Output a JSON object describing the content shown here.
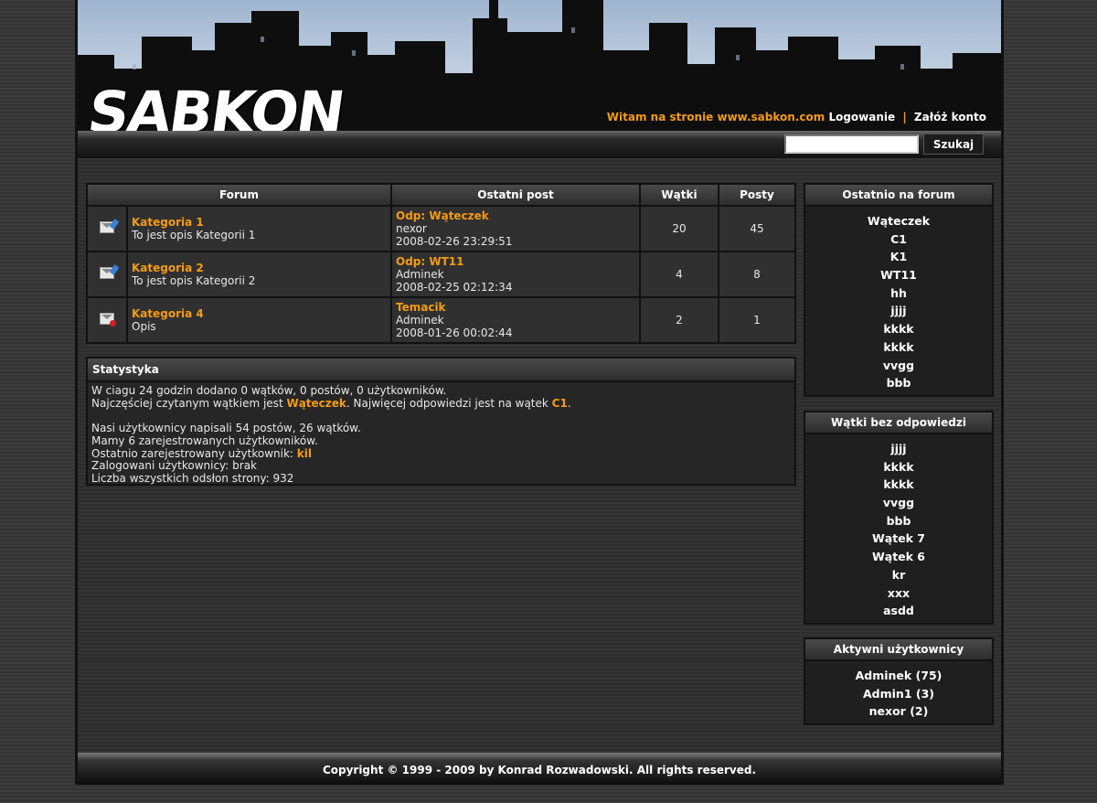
{
  "header": {
    "logo": "SABKON",
    "welcome_text": "Witam na stronie www.sabkon.com",
    "login_link": "Logowanie",
    "separator": "|",
    "register_link": "Załóż konto"
  },
  "search": {
    "value": "",
    "button_label": "Szukaj"
  },
  "forum_table": {
    "headers": [
      "Forum",
      "Ostatni post",
      "Wątki",
      "Posty"
    ],
    "rows": [
      {
        "icon": "new-posts-envelope-icon",
        "name": "Kategoria 1",
        "desc": "To jest opis Kategorii 1",
        "last_title": "Odp: Wąteczek",
        "last_user": "nexor",
        "last_date": "2008-02-26 23:29:51",
        "threads": "20",
        "posts": "45"
      },
      {
        "icon": "new-posts-envelope-icon",
        "name": "Kategoria 2",
        "desc": "To jest opis Kategorii 2",
        "last_title": "Odp: WT11",
        "last_user": "Adminek",
        "last_date": "2008-02-25 02:12:34",
        "threads": "4",
        "posts": "8"
      },
      {
        "icon": "locked-envelope-icon",
        "name": "Kategoria 4",
        "desc": "Opis",
        "last_title": "Temacik",
        "last_user": "Adminek",
        "last_date": "2008-01-26 00:02:44",
        "threads": "2",
        "posts": "1"
      }
    ]
  },
  "stats": {
    "title": "Statystyka",
    "line1": "W ciagu 24 godzin dodano 0 wątków, 0 postów, 0 użytkowników.",
    "line2_pre": "Najczęściej czytanym wątkiem jest ",
    "line2_thread": "Wąteczek",
    "line2_mid": ". Najwięcej odpowiedzi jest na wątek ",
    "line2_thread2": "C1",
    "line2_post": ".",
    "line3": "Nasi użytkownicy napisali 54 postów, 26 wątków.",
    "line4": "Mamy 6 zarejestrowanych użytkowników.",
    "line5_pre": "Ostatnio zarejestrowany użytkownik: ",
    "line5_user": "kil",
    "line6": "Zalogowani użytkownicy: brak",
    "line7": "Liczba wszystkich odsłon strony: 932"
  },
  "recent": {
    "title": "Ostatnio na forum",
    "items": [
      "Wąteczek",
      "C1",
      "K1",
      "WT11",
      "hh",
      "jjjj",
      "kkkk",
      "kkkk",
      "vvgg",
      "bbb"
    ]
  },
  "unanswered": {
    "title": "Wątki bez odpowiedzi",
    "items": [
      "jjjj",
      "kkkk",
      "kkkk",
      "vvgg",
      "bbb",
      "Wątek 7",
      "Wątek 6",
      "kr",
      "xxx",
      "asdd"
    ]
  },
  "active": {
    "title": "Aktywni użytkownicy",
    "items": [
      "Adminek (75)",
      "Admin1 (3)",
      "nexor (2)"
    ]
  },
  "footer": {
    "copyright": "Copyright © 1999 - 2009 by Konrad Rozwadowski. All rights reserved."
  },
  "colors": {
    "accent": "#f39c12",
    "background": "#333333",
    "header_sky": "#b8c8dc"
  }
}
